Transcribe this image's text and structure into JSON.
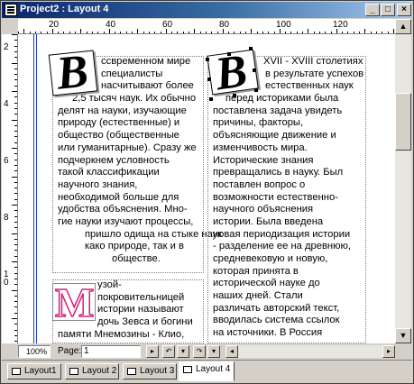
{
  "window": {
    "title": "Project2 : Layout 4",
    "min_label": "_",
    "max_label": "□",
    "close_label": "×"
  },
  "ruler_h": {
    "labels": [
      "20",
      "40",
      "60",
      "80",
      "100",
      "120"
    ]
  },
  "ruler_v": {
    "labels": [
      "2",
      "4",
      "6",
      "8",
      "10"
    ]
  },
  "dropcaps": {
    "left_letter": "B",
    "right_letter": "B",
    "bottom_letter": "М"
  },
  "column_left": {
    "lines": [
      "ссвременном мире",
      "специалисты",
      "насчитывают более",
      "2,5 тысяч наук. Их обычно",
      "делят на науки, изучающие",
      "природу (естественные) и",
      "общество (общественные",
      "или гуманитарные). Сразу же",
      "подчеркнем условность",
      "такой классификации",
      "научного знания,",
      "необходимой больше для",
      "удобства объяснения. Мно-",
      "гие науки изучают процессы,",
      "пришло одища на стыке наук",
      "како природе, так и в",
      "обществе."
    ]
  },
  "column_left_bottom": {
    "lines": [
      "узой-",
      "покровительницей",
      "истории называют",
      "дочь Зевса и богини",
      "памяти Мнемозины - Клио,"
    ]
  },
  "column_right": {
    "lines": [
      "XVII - XVIII столетиях",
      "в результате успехов",
      "естественных наук",
      "перед историками была",
      "поставлена задача увидеть",
      "причины, факторы,",
      "объясняющие движение и",
      "изменчивость мира.",
      "Исторические знания",
      "превращались в науку. Был",
      "поставлен вопрос о",
      "возможности естественно-",
      "научного объяснения",
      "истории. Была введена",
      "новая периодизация истории",
      "- разделение ее на древнюю,",
      "средневековую и новую,",
      "которая принята в",
      "исторической науке до",
      "наших дней. Стали",
      "различать авторский текст,",
      "вводилась система ссылок",
      "на источники. В Россия"
    ]
  },
  "statusbar": {
    "zoom": "100%",
    "page_label": "Page:",
    "page_value": "1"
  },
  "tabs": [
    {
      "label": "Layout1"
    },
    {
      "label": "Layout 2"
    },
    {
      "label": "Layout 3"
    },
    {
      "label": "Layout 4"
    }
  ],
  "colors": {
    "margin_guide": "#1a3cc8",
    "title_gradient_start": "#0a246a",
    "dropcap_pink": "#d0207a"
  }
}
